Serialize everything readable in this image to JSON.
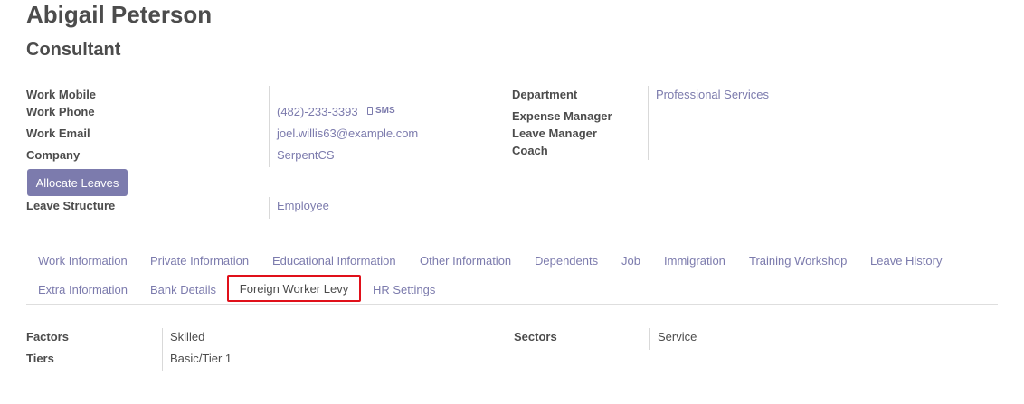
{
  "employee": {
    "name": "Abigail Peterson",
    "job_title": "Consultant"
  },
  "fields_left": {
    "work_mobile_label": "Work Mobile",
    "work_phone_label": "Work Phone",
    "work_phone_value": "(482)-233-3393",
    "sms_label": "SMS",
    "work_email_label": "Work Email",
    "work_email_value": "joel.willis63@example.com",
    "company_label": "Company",
    "company_value": "SerpentCS",
    "allocate_leaves_label": "Allocate Leaves",
    "leave_structure_label": "Leave Structure",
    "leave_structure_value": "Employee"
  },
  "fields_right": {
    "department_label": "Department",
    "department_value": "Professional Services",
    "expense_manager_label": "Expense Manager",
    "leave_manager_label": "Leave Manager",
    "coach_label": "Coach"
  },
  "tabs": {
    "row1": [
      "Work Information",
      "Private Information",
      "Educational Information",
      "Other Information",
      "Dependents",
      "Job",
      "Immigration",
      "Training Workshop",
      "Leave History"
    ],
    "row2": [
      "Extra Information",
      "Bank Details",
      "Foreign Worker Levy",
      "HR Settings"
    ],
    "active": "Foreign Worker Levy"
  },
  "levy": {
    "factors_label": "Factors",
    "factors_value": "Skilled",
    "tiers_label": "Tiers",
    "tiers_value": "Basic/Tier 1",
    "sectors_label": "Sectors",
    "sectors_value": "Service"
  },
  "colors": {
    "link": "#7c7bad",
    "primary_button": "#7c7bad",
    "highlight_border": "#e0101a",
    "text": "#4c4c4c"
  }
}
